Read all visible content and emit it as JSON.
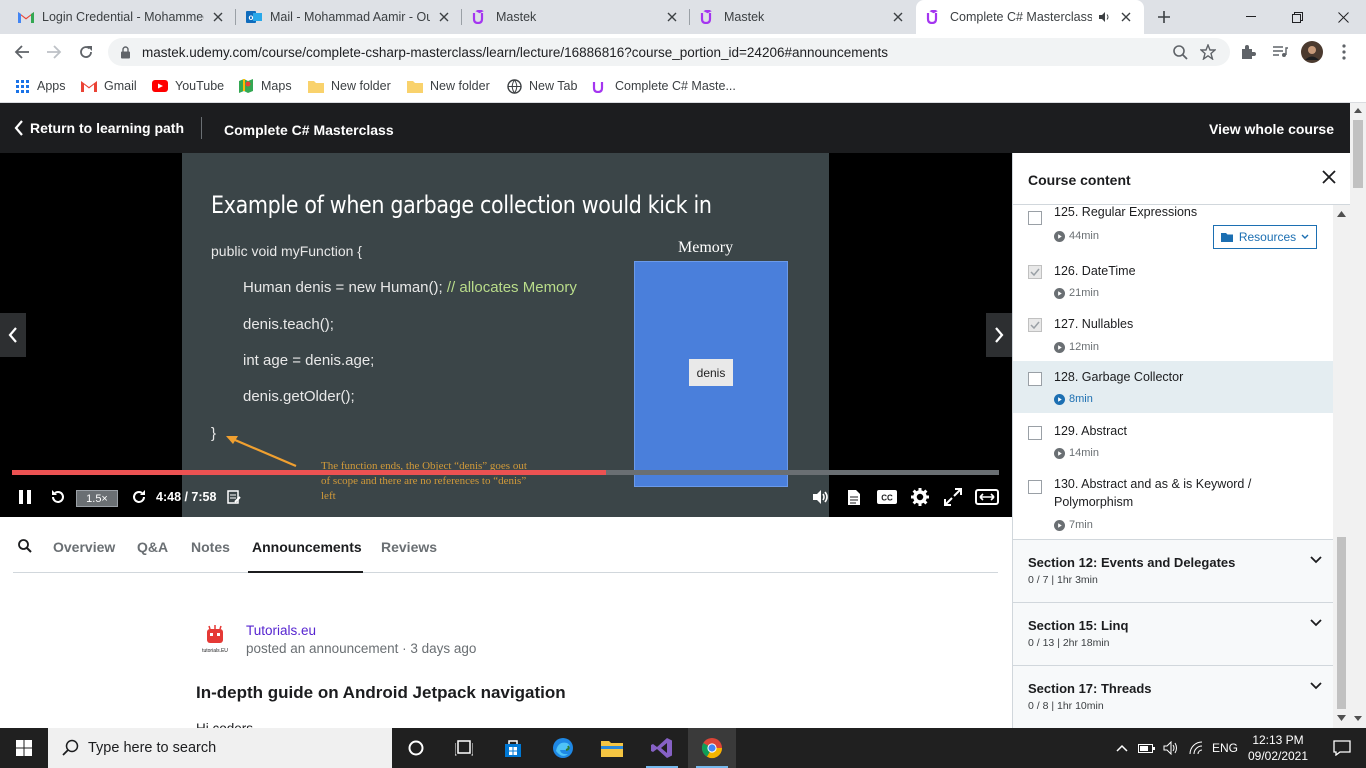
{
  "browser": {
    "tabs": [
      {
        "title": "Login Credential - Mohammed",
        "icon": "gmail-icon"
      },
      {
        "title": "Mail - Mohammad Aamir - Ou",
        "icon": "outlook-icon"
      },
      {
        "title": "Mastek",
        "icon": "udemy-icon"
      },
      {
        "title": "Mastek",
        "icon": "udemy-icon"
      },
      {
        "title": "Complete C# Masterclass",
        "icon": "udemy-icon",
        "active": true,
        "audio": true
      }
    ],
    "url": "mastek.udemy.com/course/complete-csharp-masterclass/learn/lecture/16886816?course_portion_id=24206#announcements",
    "bookmarks": [
      {
        "label": "Apps",
        "icon": "apps-grid-icon"
      },
      {
        "label": "Gmail",
        "icon": "gmail-icon"
      },
      {
        "label": "YouTube",
        "icon": "youtube-icon"
      },
      {
        "label": "Maps",
        "icon": "maps-icon"
      },
      {
        "label": "New folder",
        "icon": "folder-icon"
      },
      {
        "label": "New folder",
        "icon": "folder-icon"
      },
      {
        "label": "New Tab",
        "icon": "globe-icon"
      },
      {
        "label": "Complete C# Maste...",
        "icon": "udemy-icon"
      }
    ]
  },
  "header": {
    "return_label": "Return to learning path",
    "course_title": "Complete C# Masterclass",
    "view_course": "View whole course"
  },
  "video": {
    "slide": {
      "title": "Example of when garbage collection would kick in",
      "code_lines": [
        {
          "text": "public void myFunction {"
        },
        {
          "text": "Human denis = new Human();",
          "comment": " // allocates Memory"
        },
        {
          "text": "denis.teach();"
        },
        {
          "text": "int age = denis.age;"
        },
        {
          "text": "denis.getOlder();"
        },
        {
          "text": "}"
        }
      ],
      "memory_label": "Memory",
      "memory_object": "denis",
      "note": "The function ends, the Object “denis” goes out of scope and there are no references to “denis” left"
    },
    "speed": "1.5×",
    "time": "4:48 / 7:58",
    "progress_fraction": 0.602,
    "accent": "#ec5252"
  },
  "content_tabs": [
    {
      "label": "Overview"
    },
    {
      "label": "Q&A"
    },
    {
      "label": "Notes"
    },
    {
      "label": "Announcements",
      "active": true
    },
    {
      "label": "Reviews"
    }
  ],
  "announcement": {
    "author": "Tutorials.eu",
    "logo_text": "tutorials.EU",
    "meta": "posted an announcement · 3 days ago",
    "title": "In-depth guide on Android Jetpack navigation",
    "body": "Hi coders,"
  },
  "sidebar": {
    "title": "Course content",
    "lectures": [
      {
        "name": "125. Regular Expressions",
        "duration": "44min",
        "checked": false,
        "resources": "Resources"
      },
      {
        "name": "126. DateTime",
        "duration": "21min",
        "checked": true
      },
      {
        "name": "127. Nullables",
        "duration": "12min",
        "checked": true
      },
      {
        "name": "128. Garbage Collector",
        "duration": "8min",
        "checked": false,
        "current": true
      },
      {
        "name": "129. Abstract",
        "duration": "14min",
        "checked": false
      },
      {
        "name": "130. Abstract and as & is Keyword / Polymorphism",
        "duration": "7min",
        "checked": false
      }
    ],
    "sections": [
      {
        "title": "Section 12: Events and Delegates",
        "sub": "0 / 7 | 1hr 3min"
      },
      {
        "title": "Section 15: Linq",
        "sub": "0 / 13 | 2hr 18min"
      },
      {
        "title": "Section 17: Threads",
        "sub": "0 / 8 | 1hr 10min"
      }
    ]
  },
  "taskbar": {
    "search_placeholder": "Type here to search",
    "apps": [
      "cortana-icon",
      "task-view-icon",
      "store-icon",
      "edge-icon",
      "file-explorer-icon",
      "visual-studio-icon",
      "chrome-icon"
    ],
    "lang": "ENG",
    "time": "12:13 PM",
    "date": "09/02/2021"
  }
}
